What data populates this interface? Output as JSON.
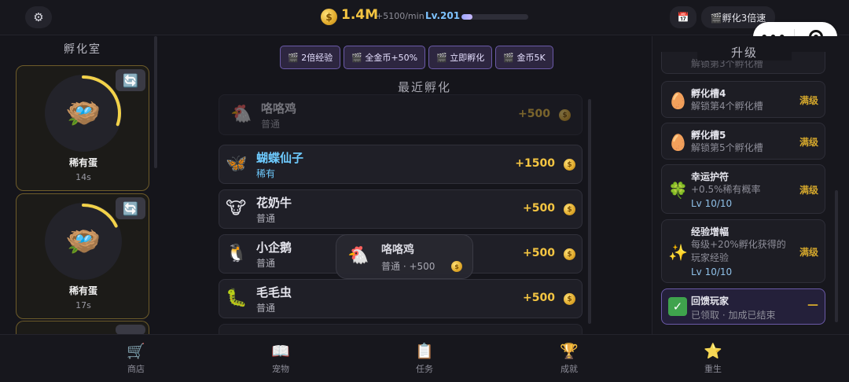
{
  "header": {
    "coins": "1.4M",
    "coin_symbol": "$",
    "rate": "+5100/min",
    "level": "Lv.201",
    "xp_progress": 0.17,
    "calendar_icon": "calendar-icon",
    "speed_button_label": "🎬孵化3倍速"
  },
  "incubator": {
    "title": "孵化室",
    "slots": [
      {
        "name": "稀有蛋",
        "time": "14s",
        "progress": 0.3
      },
      {
        "name": "稀有蛋",
        "time": "17s",
        "progress": 0.18
      }
    ]
  },
  "boosts": [
    {
      "label": "🎬 2倍经验"
    },
    {
      "label": "🎬 全金币+50%"
    },
    {
      "label": "🎬 立即孵化"
    },
    {
      "label": "🎬 金币5K"
    }
  ],
  "recent": {
    "title": "最近孵化",
    "items": [
      {
        "icon": "🐔",
        "name": "咯咯鸡",
        "rarity": "普通",
        "reward": "+500"
      },
      {
        "icon": "🦋",
        "name": "蝴蝶仙子",
        "rarity": "稀有",
        "reward": "+1500"
      },
      {
        "icon": "🐮",
        "name": "花奶牛",
        "rarity": "普通",
        "reward": "+500"
      },
      {
        "icon": "🐧",
        "name": "小企鹅",
        "rarity": "普通",
        "reward": "+500"
      },
      {
        "icon": "🐛",
        "name": "毛毛虫",
        "rarity": "普通",
        "reward": "+500"
      }
    ]
  },
  "toast": {
    "icon": "🐔",
    "name": "咯咯鸡",
    "detail": "普通 · +500"
  },
  "upgrades": {
    "title": "升级",
    "partial_desc": "解锁第3个孵化槽",
    "items": [
      {
        "icon": "🥚",
        "title": "孵化槽4",
        "desc": "解锁第4个孵化槽",
        "status": "满级"
      },
      {
        "icon": "🥚",
        "title": "孵化槽5",
        "desc": "解锁第5个孵化槽",
        "status": "满级"
      },
      {
        "icon": "🍀",
        "title": "幸运护符",
        "desc": "+0.5%稀有概率",
        "level": "Lv 10/10",
        "status": "满级"
      },
      {
        "icon": "✨",
        "title": "经验增幅",
        "desc_line1": "每级+20%孵化获得的",
        "desc_line2": "玩家经验",
        "level": "Lv 10/10",
        "status": "满级"
      }
    ],
    "feedback": {
      "icon": "✓",
      "title": "回馈玩家",
      "desc": "已领取 · 加成已结束",
      "status": "—"
    }
  },
  "nav": [
    {
      "icon": "🛒",
      "label": "商店"
    },
    {
      "icon": "📖",
      "label": "宠物"
    },
    {
      "icon": "📋",
      "label": "任务"
    },
    {
      "icon": "🏆",
      "label": "成就"
    },
    {
      "icon": "⭐",
      "label": "重生"
    }
  ]
}
